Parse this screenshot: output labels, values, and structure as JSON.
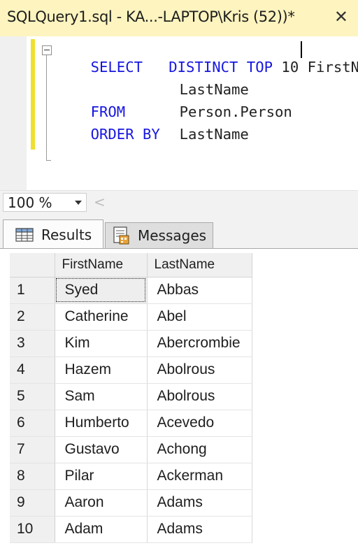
{
  "window": {
    "tab_title": "SQLQuery1.sql - KA...-LAPTOP\\Kris (52))*",
    "close_glyph": "✕"
  },
  "editor": {
    "lines": [
      {
        "kw1": "SELECT",
        "kw2": "DISTINCT TOP",
        "num": "10",
        "rest": "FirstN"
      },
      {
        "text": "LastName"
      },
      {
        "kw1": "FROM",
        "text": "Person.Person"
      },
      {
        "kw1": "ORDER BY",
        "text": "LastName"
      }
    ],
    "keyword_color": "#1616e0",
    "change_bar_color": "#efe02e"
  },
  "zoom": {
    "value": "100 %",
    "scroll_glyph": "<"
  },
  "result_tabs": [
    {
      "label": "Results",
      "icon": "grid-icon",
      "active": true
    },
    {
      "label": "Messages",
      "icon": "messages-icon",
      "active": false
    }
  ],
  "grid": {
    "columns": [
      "",
      "FirstName",
      "LastName"
    ],
    "rows": [
      [
        "1",
        "Syed",
        "Abbas"
      ],
      [
        "2",
        "Catherine",
        "Abel"
      ],
      [
        "3",
        "Kim",
        "Abercrombie"
      ],
      [
        "4",
        "Hazem",
        "Abolrous"
      ],
      [
        "5",
        "Sam",
        "Abolrous"
      ],
      [
        "6",
        "Humberto",
        "Acevedo"
      ],
      [
        "7",
        "Gustavo",
        "Achong"
      ],
      [
        "8",
        "Pilar",
        "Ackerman"
      ],
      [
        "9",
        "Aaron",
        "Adams"
      ],
      [
        "10",
        "Adam",
        "Adams"
      ]
    ],
    "selected_cell": "Syed"
  }
}
